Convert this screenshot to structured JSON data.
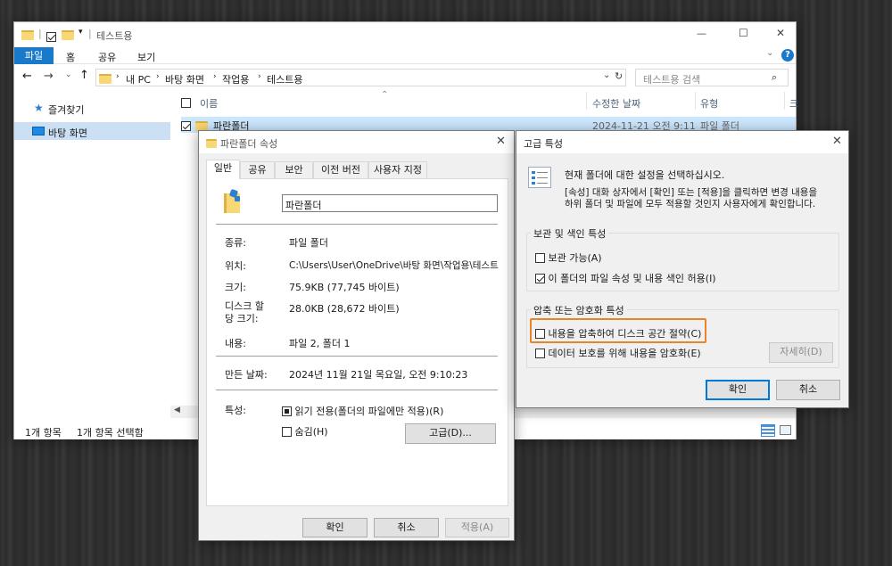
{
  "explorer": {
    "title": "테스트용",
    "window_controls": {
      "minimize": "—",
      "maximize": "☐",
      "close": "✕"
    },
    "ribbon_tabs": [
      "파일",
      "홈",
      "공유",
      "보기"
    ],
    "address": [
      "내 PC",
      "바탕 화면",
      "작업용",
      "테스트용"
    ],
    "search_placeholder": "테스트용 검색",
    "columns": {
      "name": "이름",
      "modified": "수정한 날짜",
      "type": "유형",
      "more": "크"
    },
    "nav": [
      {
        "label": "즐겨찾기"
      },
      {
        "label": "바탕 화면"
      }
    ],
    "rows": [
      {
        "name": "파란폴더",
        "modified": "2024-11-21 오전 9:11",
        "type": "파일 폴더"
      }
    ],
    "status": {
      "count": "1개 항목",
      "selected": "1개 항목 선택함"
    }
  },
  "props": {
    "title": "파란폴더 속성",
    "tabs": [
      "일반",
      "공유",
      "보안",
      "이전 버전",
      "사용자 지정"
    ],
    "name": "파란폴더",
    "rows": [
      {
        "label": "종류:",
        "value": "파일 폴더"
      },
      {
        "label": "위치:",
        "value": "C:\\Users\\User\\OneDrive\\바탕 화면\\작업용\\테스트"
      },
      {
        "label": "크기:",
        "value": "75.9KB (77,745 바이트)"
      },
      {
        "label": "디스크 할\n당 크기:",
        "value": "28.0KB (28,672 바이트)"
      },
      {
        "label": "내용:",
        "value": "파일 2, 폴더 1"
      },
      {
        "label": "만든 날짜:",
        "value": "2024년 11월 21일 목요일, 오전 9:10:23"
      }
    ],
    "attributes_label": "특성:",
    "readonly": "읽기 전용(폴더의 파일에만 적용)(R)",
    "hidden": "숨김(H)",
    "advanced_btn": "고급(D)...",
    "ok": "확인",
    "cancel": "취소",
    "apply": "적용(A)"
  },
  "adv": {
    "title": "고급 특성",
    "desc1": "현재 폴더에 대한 설정을 선택하십시오.",
    "desc2": "[속성] 대화 상자에서 [확인] 또는 [적용]을 클릭하면 변경 내용을",
    "desc3": "하위 폴더 및 파일에 모두 적용할 것인지 사용자에게 확인합니다.",
    "group1": "보관 및 색인 특성",
    "archive": "보관 가능(A)",
    "index": "이 폴더의 파일 속성 및 내용 색인 허용(I)",
    "group2": "압축 또는 암호화 특성",
    "compress": "내용을 압축하여 디스크 공간 절약(C)",
    "encrypt": "데이터 보호를 위해 내용을 암호화(E)",
    "details": "자세히(D)",
    "ok": "확인",
    "cancel": "취소",
    "highlight_color": "#e8842a"
  }
}
